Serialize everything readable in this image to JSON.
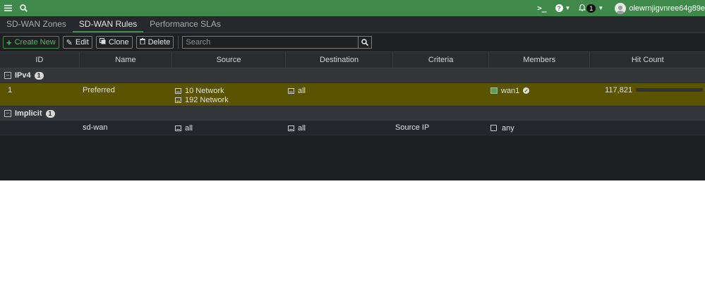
{
  "topbar": {
    "menu_icon": "hamburger-icon",
    "search_icon": "search-icon",
    "cli_icon": "terminal-icon",
    "help_icon": "help-icon",
    "bell_icon": "bell-icon",
    "notification_count": "1",
    "username": "olewrnjigvnree64g89e"
  },
  "tabs": [
    {
      "label": "SD-WAN Zones",
      "active": false
    },
    {
      "label": "SD-WAN Rules",
      "active": true
    },
    {
      "label": "Performance SLAs",
      "active": false
    }
  ],
  "toolbar": {
    "create_label": "Create New",
    "edit_label": "Edit",
    "clone_label": "Clone",
    "delete_label": "Delete",
    "search_placeholder": "Search"
  },
  "table": {
    "columns": [
      "ID",
      "Name",
      "Source",
      "Destination",
      "Criteria",
      "Members",
      "Hit Count"
    ],
    "groups": [
      {
        "label": "IPv4",
        "count": "1",
        "rows": [
          {
            "id": "1",
            "name": "Preferred",
            "source": [
              "10 Network",
              "192 Network"
            ],
            "destination": [
              "all"
            ],
            "criteria": "",
            "members": "wan1",
            "hit_count": "117,821",
            "hit_fraction": 1.0
          }
        ]
      },
      {
        "label": "Implicit",
        "count": "1",
        "rows": [
          {
            "id": "",
            "name": "sd-wan",
            "source": [
              "all"
            ],
            "destination": [
              "all"
            ],
            "criteria": "Source IP",
            "members": "any",
            "hit_count": ""
          }
        ]
      }
    ]
  },
  "colors": {
    "topbar": "#3f8a4b",
    "selected_row": "#5a5400"
  }
}
